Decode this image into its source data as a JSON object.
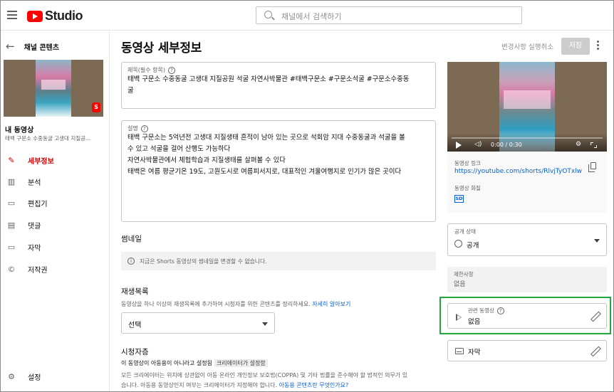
{
  "header": {
    "logo_text": "Studio",
    "search_placeholder": "채널에서 검색하기"
  },
  "sidebar": {
    "back_label": "채널 콘텐츠",
    "my_video_title": "내 동영상",
    "my_video_subtitle": "태백 구문소 수중동굴 고생대 지질공...",
    "items": [
      {
        "label": "세부정보",
        "icon": "pencil-icon",
        "active": true
      },
      {
        "label": "분석",
        "icon": "analytics-icon",
        "active": false
      },
      {
        "label": "편집기",
        "icon": "editor-icon",
        "active": false
      },
      {
        "label": "댓글",
        "icon": "comments-icon",
        "active": false
      },
      {
        "label": "자막",
        "icon": "subtitles-icon",
        "active": false
      },
      {
        "label": "저작권",
        "icon": "copyright-icon",
        "active": false
      }
    ],
    "settings_label": "설정"
  },
  "main": {
    "page_title": "동영상 세부정보",
    "undo_label": "변경사항 실행취소",
    "save_label": "저장",
    "title_field": {
      "label": "제목(필수 항목)",
      "value_line1": "태백 구문소 수중동굴 고생대 지질공원 석굴 자연사박물관 #태백구문소 #구문소석굴 #구문소수중동",
      "value_line2": "굴"
    },
    "description_field": {
      "label": "설명",
      "lines": [
        "태백 구문소는 5억년전 고생대 지질생태 흔적이 남아 있는 곳으로 석회암 지대 수중동굴과 석굴을 볼",
        "수 있고 석굴을 걸어 산행도 가능하다",
        "자연사박물관에서 체험학습과 지질생태를 살펴볼 수 있다",
        "태백은 여름 평균기온 19도, 고원도시로 여름피서지로, 대표적인 겨울여행지로 인기가 많은 곳이다"
      ]
    },
    "thumbnail": {
      "title": "썸네일",
      "notice": "지금은 Shorts 동영상의 썸네일을 변경할 수 없습니다."
    },
    "playlist": {
      "title": "재생목록",
      "description": "동영상을 하나 이상의 재생목록에 추가하여 시청자를 위한 콘텐츠를 정리하세요.",
      "link": "자세히 알아보기",
      "select_value": "선택"
    },
    "audience": {
      "title": "시청자층",
      "status": "이 동영상이 아동용이 아니라고 설정됨",
      "tag": "크리에이터가 설정함",
      "text_line1": "모든 크리에이터는 위치에 상관없이 아동 온라인 개인정보 보호법(COPPA) 및 기타 법률을 준수해야 할 법적인 의무가 있",
      "text_line2": "습니다. 아동용 동영상인지 여부는 크리에이터가 지정해야 합니다.",
      "link": "아동용 콘텐츠란 무엇인가요?"
    }
  },
  "right": {
    "player": {
      "time": "0:00 / 0:30",
      "progress": 0
    },
    "video_link_label": "동영상 링크",
    "video_link": "https://youtube.com/shorts/RlvjTyOTxlw",
    "quality_label": "동영상 화질",
    "quality_badge": "SD",
    "visibility": {
      "label": "공개 상태",
      "value": "공개"
    },
    "restrictions": {
      "label": "제한사항",
      "value": "없음"
    },
    "related": {
      "label": "관련 동영상",
      "value": "없음"
    },
    "subtitles_label": "자막"
  },
  "colors": {
    "accent_red": "#cc0000",
    "link_blue": "#065fd4",
    "highlight_green": "#22a83c"
  }
}
